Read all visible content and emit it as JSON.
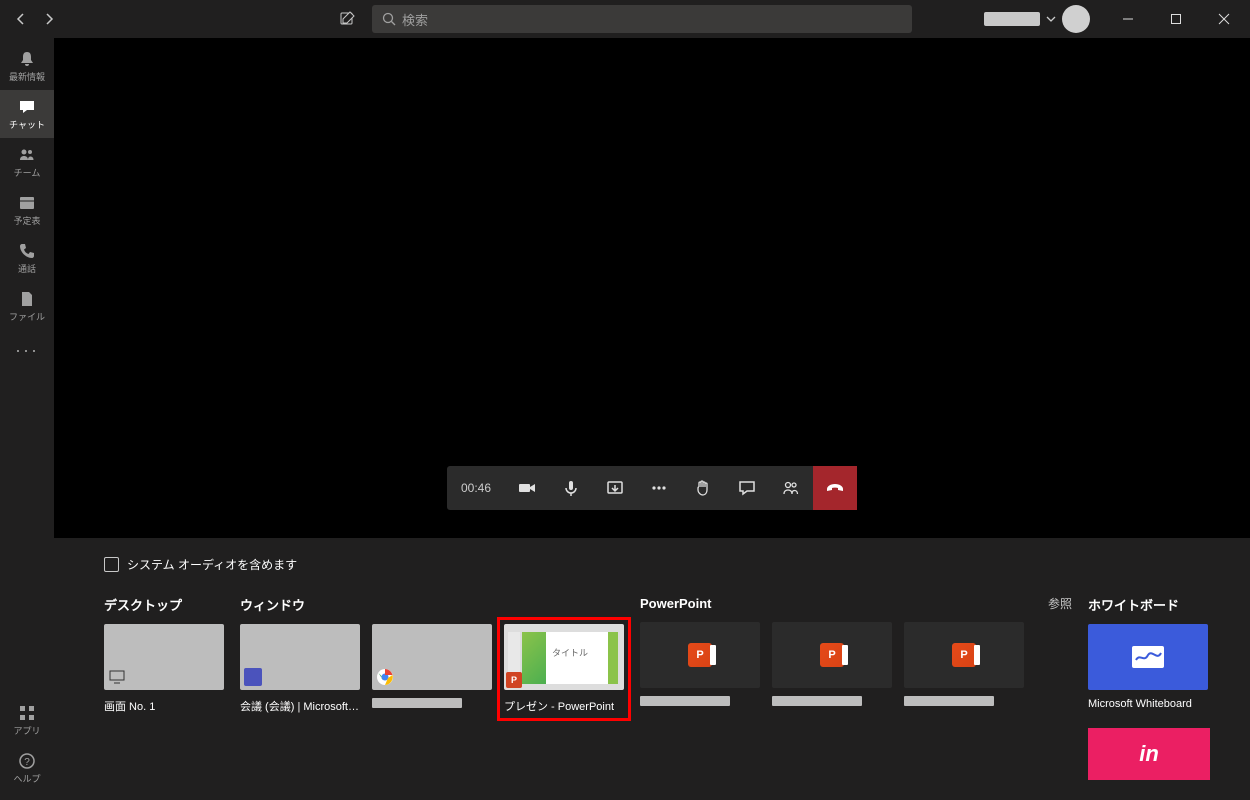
{
  "titlebar": {
    "search_placeholder": "検索"
  },
  "rail": {
    "activity": "最新情報",
    "chat": "チャット",
    "teams": "チーム",
    "calendar": "予定表",
    "calls": "通話",
    "files": "ファイル",
    "apps": "アプリ",
    "help": "ヘルプ"
  },
  "meeting": {
    "timer": "00:46"
  },
  "tray": {
    "include_audio": "システム オーディオを含めます",
    "desktop_header": "デスクトップ",
    "window_header": "ウィンドウ",
    "powerpoint_header": "PowerPoint",
    "browse": "参照",
    "whiteboard_header": "ホワイトボード",
    "desktop_items": [
      {
        "label": "画面 No. 1"
      }
    ],
    "window_items": [
      {
        "label": "会議 (会議) | Microsoft Te..."
      },
      {
        "label": ""
      },
      {
        "label": "プレゼン - PowerPoint",
        "highlighted": true,
        "preview_title": "タイトル"
      }
    ],
    "whiteboard_items": [
      {
        "label": "Microsoft Whiteboard"
      }
    ],
    "invision_label": "in"
  }
}
